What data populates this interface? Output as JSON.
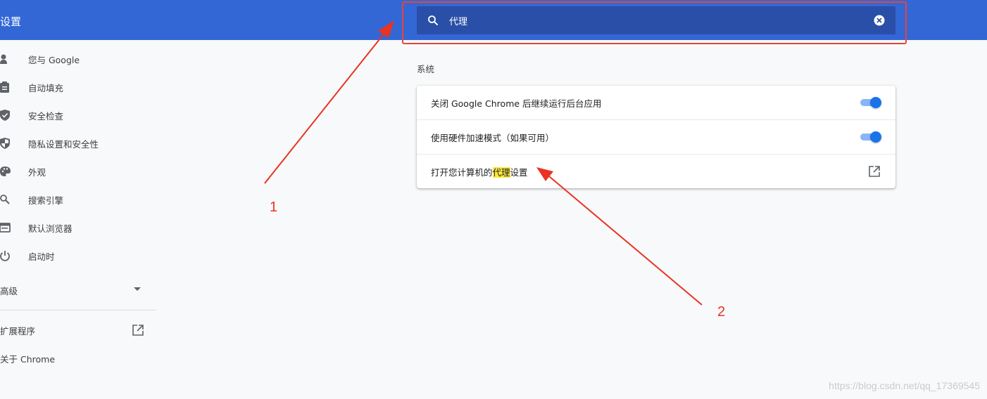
{
  "header": {
    "title": "设置",
    "search": {
      "value": "代理",
      "icon": "search-icon",
      "clear_icon": "clear-icon"
    }
  },
  "sidebar": {
    "items": [
      {
        "label": "您与 Google",
        "icon": "person-icon"
      },
      {
        "label": "自动填充",
        "icon": "clipboard-icon"
      },
      {
        "label": "安全检查",
        "icon": "shield-check-icon"
      },
      {
        "label": "隐私设置和安全性",
        "icon": "shield-half-icon"
      },
      {
        "label": "外观",
        "icon": "palette-icon"
      },
      {
        "label": "搜索引擎",
        "icon": "search-icon"
      },
      {
        "label": "默认浏览器",
        "icon": "browser-icon"
      },
      {
        "label": "启动时",
        "icon": "power-icon"
      }
    ],
    "advanced": "高级",
    "extensions": "扩展程序",
    "about": "关于 Chrome"
  },
  "main": {
    "section_title": "系统",
    "rows": [
      {
        "label": "关闭 Google Chrome 后继续运行后台应用",
        "toggle_on": true
      },
      {
        "label": "使用硬件加速模式（如果可用）",
        "toggle_on": true
      },
      {
        "label_before": "打开您计算机的",
        "label_highlight": "代理",
        "label_after": "设置",
        "icon": "open-in-new-icon"
      }
    ]
  },
  "annotations": {
    "label1": "1",
    "label2": "2"
  },
  "watermark": "https://blog.csdn.net/qq_17369545",
  "colors": {
    "header": "#3367d6",
    "search_box": "#2a4fa8",
    "toggle": "#1a73e8",
    "annotation": "#ea3323",
    "highlight": "#fde73c"
  }
}
